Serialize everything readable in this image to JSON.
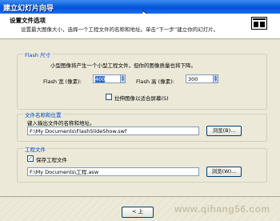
{
  "window": {
    "title": "建立幻灯片向导"
  },
  "header": {
    "title": "设置文件选项",
    "description": "设置最大图像大小，选择一个工程文件的名称和地址。单击“下一步”建立你的幻灯片。"
  },
  "flash_size": {
    "legend": "Flash 尺寸",
    "description": "小型图像将产生一个小型工程文件，但你的图像质量也将下降。",
    "width_label": "Flash 宽 (像素):",
    "width_value": "400",
    "height_label": "Flash 高 (像素):",
    "height_value": "300",
    "fit_screen_label": "拉伸图像以适合屏幕(S)",
    "fit_screen_checked": false
  },
  "file_location": {
    "legend": "文件名称和位置",
    "description": "键入输出文件的名称和地址。",
    "path_value": "F:\\My Documents\\FlashSlideShow.swf",
    "browse_label": "浏览(B)..."
  },
  "project_file": {
    "legend": "工程文件",
    "save_label": "保存工程文件",
    "save_checked": true,
    "path_value": "F:\\My Documents\\工程.asw",
    "browse_label": "浏览(W)..."
  },
  "footer": {
    "back_label": "< 上",
    "watermark": "www.qihang56.com"
  },
  "colors": {
    "titlebar": "#0054e3",
    "legend": "#0046d5",
    "dialog": "#ece9d8",
    "selection": "#316ac5"
  }
}
